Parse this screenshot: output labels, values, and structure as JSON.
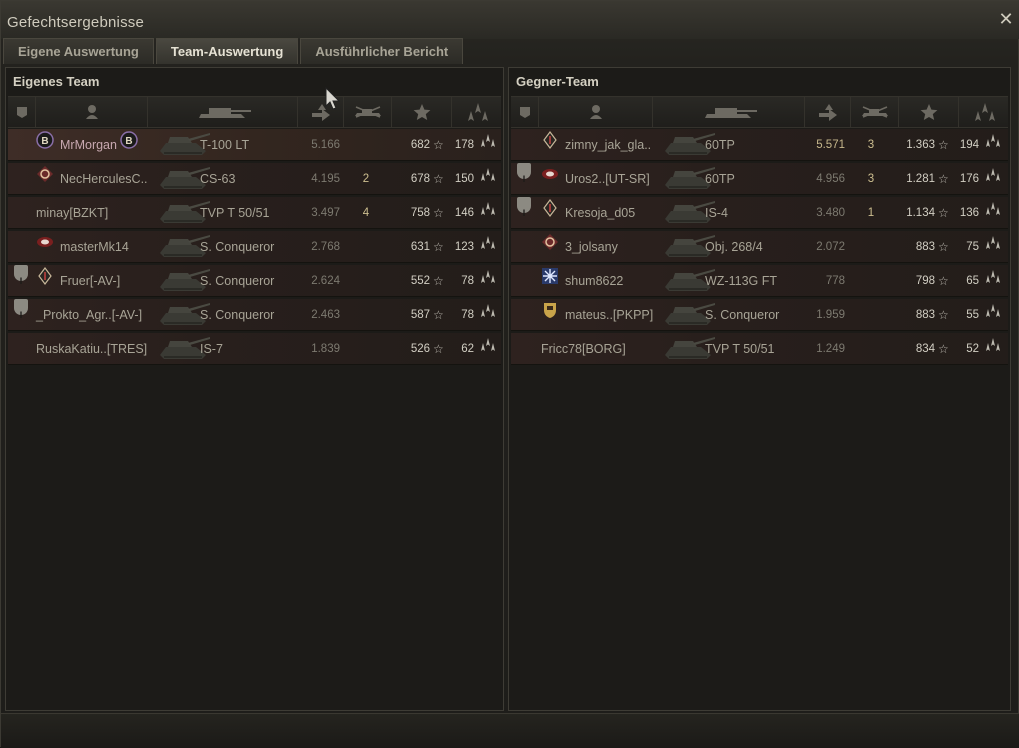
{
  "window": {
    "title": "Gefechtsergebnisse"
  },
  "tabs": [
    {
      "label": "Eigene Auswertung",
      "active": false
    },
    {
      "label": "Team-Auswertung",
      "active": true
    },
    {
      "label": "Ausführlicher Bericht",
      "active": false
    }
  ],
  "own_team": {
    "title": "Eigenes Team",
    "columns": [
      "squad-icon",
      "player-icon",
      "tank-icon",
      "damage-icon",
      "kills-icon",
      "xp-star-icon",
      "medal-icon"
    ],
    "rows": [
      {
        "squad": "",
        "clan": "B-badge",
        "player": "MrMorgan",
        "tank": "T-100 LT",
        "damage": "5.166",
        "kills": "",
        "xp": "682",
        "credits": "178",
        "self": true
      },
      {
        "squad": "",
        "clan": "target-badge",
        "player": "NecHerculesC..",
        "tank": "CS-63",
        "damage": "4.195",
        "kills": "2",
        "xp": "678",
        "credits": "150"
      },
      {
        "squad": "",
        "clan": "",
        "player": "minay[BZKT]",
        "tank": "TVP T 50/51",
        "damage": "3.497",
        "kills": "4",
        "xp": "758",
        "credits": "146"
      },
      {
        "squad": "",
        "clan": "eye-badge",
        "player": "masterMk14",
        "tank": "S. Conqueror",
        "damage": "2.768",
        "kills": "",
        "xp": "631",
        "credits": "123"
      },
      {
        "squad": "I",
        "clan": "diamond-badge",
        "player": "Fruer[-AV-]",
        "tank": "S. Conqueror",
        "damage": "2.624",
        "kills": "",
        "xp": "552",
        "credits": "78"
      },
      {
        "squad": "I",
        "clan": "",
        "player": "_Prokto_Agr..[-AV-]",
        "tank": "S. Conqueror",
        "damage": "2.463",
        "kills": "",
        "xp": "587",
        "credits": "78"
      },
      {
        "squad": "",
        "clan": "",
        "player": "RuskaKatiu..[TRES]",
        "tank": "IS-7",
        "damage": "1.839",
        "kills": "",
        "xp": "526",
        "credits": "62"
      }
    ]
  },
  "enemy_team": {
    "title": "Gegner-Team",
    "rows": [
      {
        "squad": "",
        "clan": "diamond-badge",
        "player": "zimny_jak_gla..",
        "tank": "60TP",
        "damage": "5.571",
        "kills": "3",
        "xp": "1.363",
        "credits": "194",
        "highlight": true
      },
      {
        "squad": "I",
        "clan": "eye-badge",
        "player": "Uros2..[UT-SR]",
        "tank": "60TP",
        "damage": "4.956",
        "kills": "3",
        "xp": "1.281",
        "credits": "176"
      },
      {
        "squad": "I",
        "clan": "diamond-badge",
        "player": "Kresoja_d05",
        "tank": "IS-4",
        "damage": "3.480",
        "kills": "1",
        "xp": "1.134",
        "credits": "136"
      },
      {
        "squad": "",
        "clan": "target-badge",
        "player": "3_jolsany",
        "tank": "Obj. 268/4",
        "damage": "2.072",
        "kills": "",
        "xp": "883",
        "credits": "75"
      },
      {
        "squad": "",
        "clan": "snowflake-badge",
        "player": "shum8622",
        "tank": "WZ-113G FT",
        "damage": "778",
        "kills": "",
        "xp": "798",
        "credits": "65"
      },
      {
        "squad": "",
        "clan": "shield-badge",
        "player": "mateus..[PKPP]",
        "tank": "S. Conqueror",
        "damage": "1.959",
        "kills": "",
        "xp": "883",
        "credits": "55"
      },
      {
        "squad": "",
        "clan": "",
        "player": "Fricc78[BORG]",
        "tank": "TVP T 50/51",
        "damage": "1.249",
        "kills": "",
        "xp": "834",
        "credits": "52"
      }
    ]
  },
  "colors": {
    "text": "#a8a496",
    "self_name": "#c8a8b0",
    "kills": "#cdbf90",
    "row_bg": "#2e221f"
  }
}
